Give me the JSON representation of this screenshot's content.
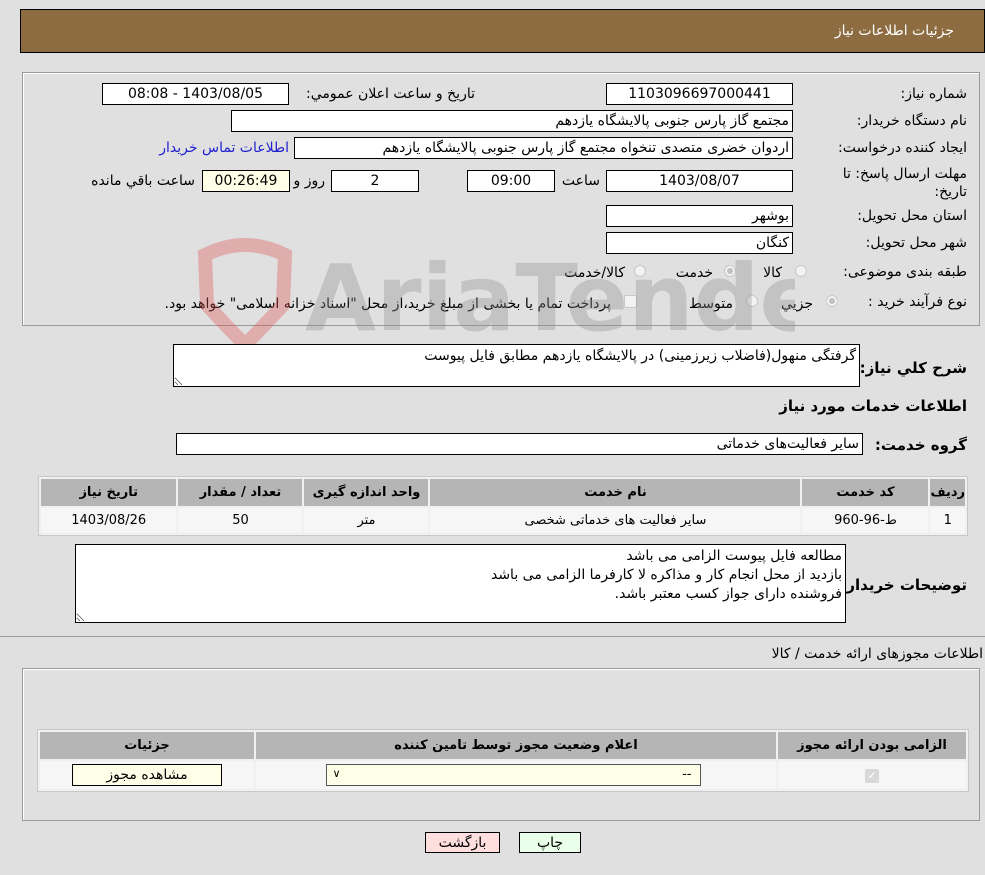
{
  "header": {
    "title": "جزئیات اطلاعات نیاز"
  },
  "form": {
    "need_number_label": "شماره نیاز:",
    "need_number": "1103096697000441",
    "announce_label": "تاریخ و ساعت اعلان عمومي:",
    "announce_value": "1403/08/05 - 08:08",
    "buyer_org_label": "نام دستگاه خریدار:",
    "buyer_org": "مجتمع گاز پارس جنوبی  پالایشگاه یازدهم",
    "creator_label": "ایجاد کننده درخواست:",
    "creator": "اردوان خضری متصدی تنخواه مجتمع گاز پارس جنوبی  پالایشگاه یازدهم",
    "contact_link": "اطلاعات تماس خریدار",
    "deadline_label": "مهلت ارسال پاسخ: تا تاریخ:",
    "deadline_date": "1403/08/07",
    "time_label": "ساعت",
    "deadline_time": "09:00",
    "days": "2",
    "days_label": "روز و",
    "remaining": "00:26:49",
    "remaining_label": "ساعت باقي مانده",
    "province_label": "استان محل تحویل:",
    "province": "بوشهر",
    "city_label": "شهر محل تحویل:",
    "city": "کنگان",
    "category_label": "طبقه بندی موضوعی:",
    "category_options": [
      {
        "label": "کالا",
        "selected": false
      },
      {
        "label": "خدمت",
        "selected": true
      },
      {
        "label": "کالا/خدمت",
        "selected": false
      }
    ],
    "process_label": "نوع فرآیند خرید :",
    "process_options": [
      {
        "label": "جزيي",
        "selected": true
      },
      {
        "label": "متوسط",
        "selected": false
      }
    ],
    "treasury_note": "پرداخت تمام یا بخشی از مبلغ خرید،از محل \"اسناد خزانه اسلامی\" خواهد بود."
  },
  "description": {
    "label": "شرح کلي نیاز:",
    "value": "گرفتگی منهول(فاضلاب زیرزمینی) در پالایشگاه یازدهم مطابق فایل پیوست"
  },
  "services": {
    "section_title": "اطلاعات خدمات مورد نیاز",
    "group_label": "گروه خدمت:",
    "group_value": "سایر فعالیت‌های خدماتی",
    "columns": [
      "ردیف",
      "کد خدمت",
      "نام خدمت",
      "واحد اندازه گیری",
      "تعداد / مقدار",
      "تاریخ نیاز"
    ],
    "rows": [
      [
        "1",
        "ط-96-960",
        "سایر فعالیت های خدماتی شخصی",
        "متر",
        "50",
        "1403/08/26"
      ]
    ]
  },
  "buyer_notes": {
    "label": "توضیحات خریدار:",
    "value": "مطالعه فایل پیوست الزامی می باشد\nبازدید از محل انجام کار و مذاکره لا کارفرما الزامی می باشد\nفروشنده دارای جواز کسب معتبر باشد."
  },
  "licenses": {
    "section_title": "اطلاعات مجوزهای ارائه خدمت / کالا",
    "columns": [
      "الزامی بودن ارائه مجوز",
      "اعلام وضعیت مجوز توسط تامین کننده",
      "جزئیات"
    ],
    "row": {
      "required_checked": true,
      "status_value": "--",
      "details_button": "مشاهده مجوز"
    }
  },
  "buttons": {
    "print": "چاپ",
    "back": "بازگشت"
  },
  "watermark": {
    "text": "AriaTender.neT"
  }
}
